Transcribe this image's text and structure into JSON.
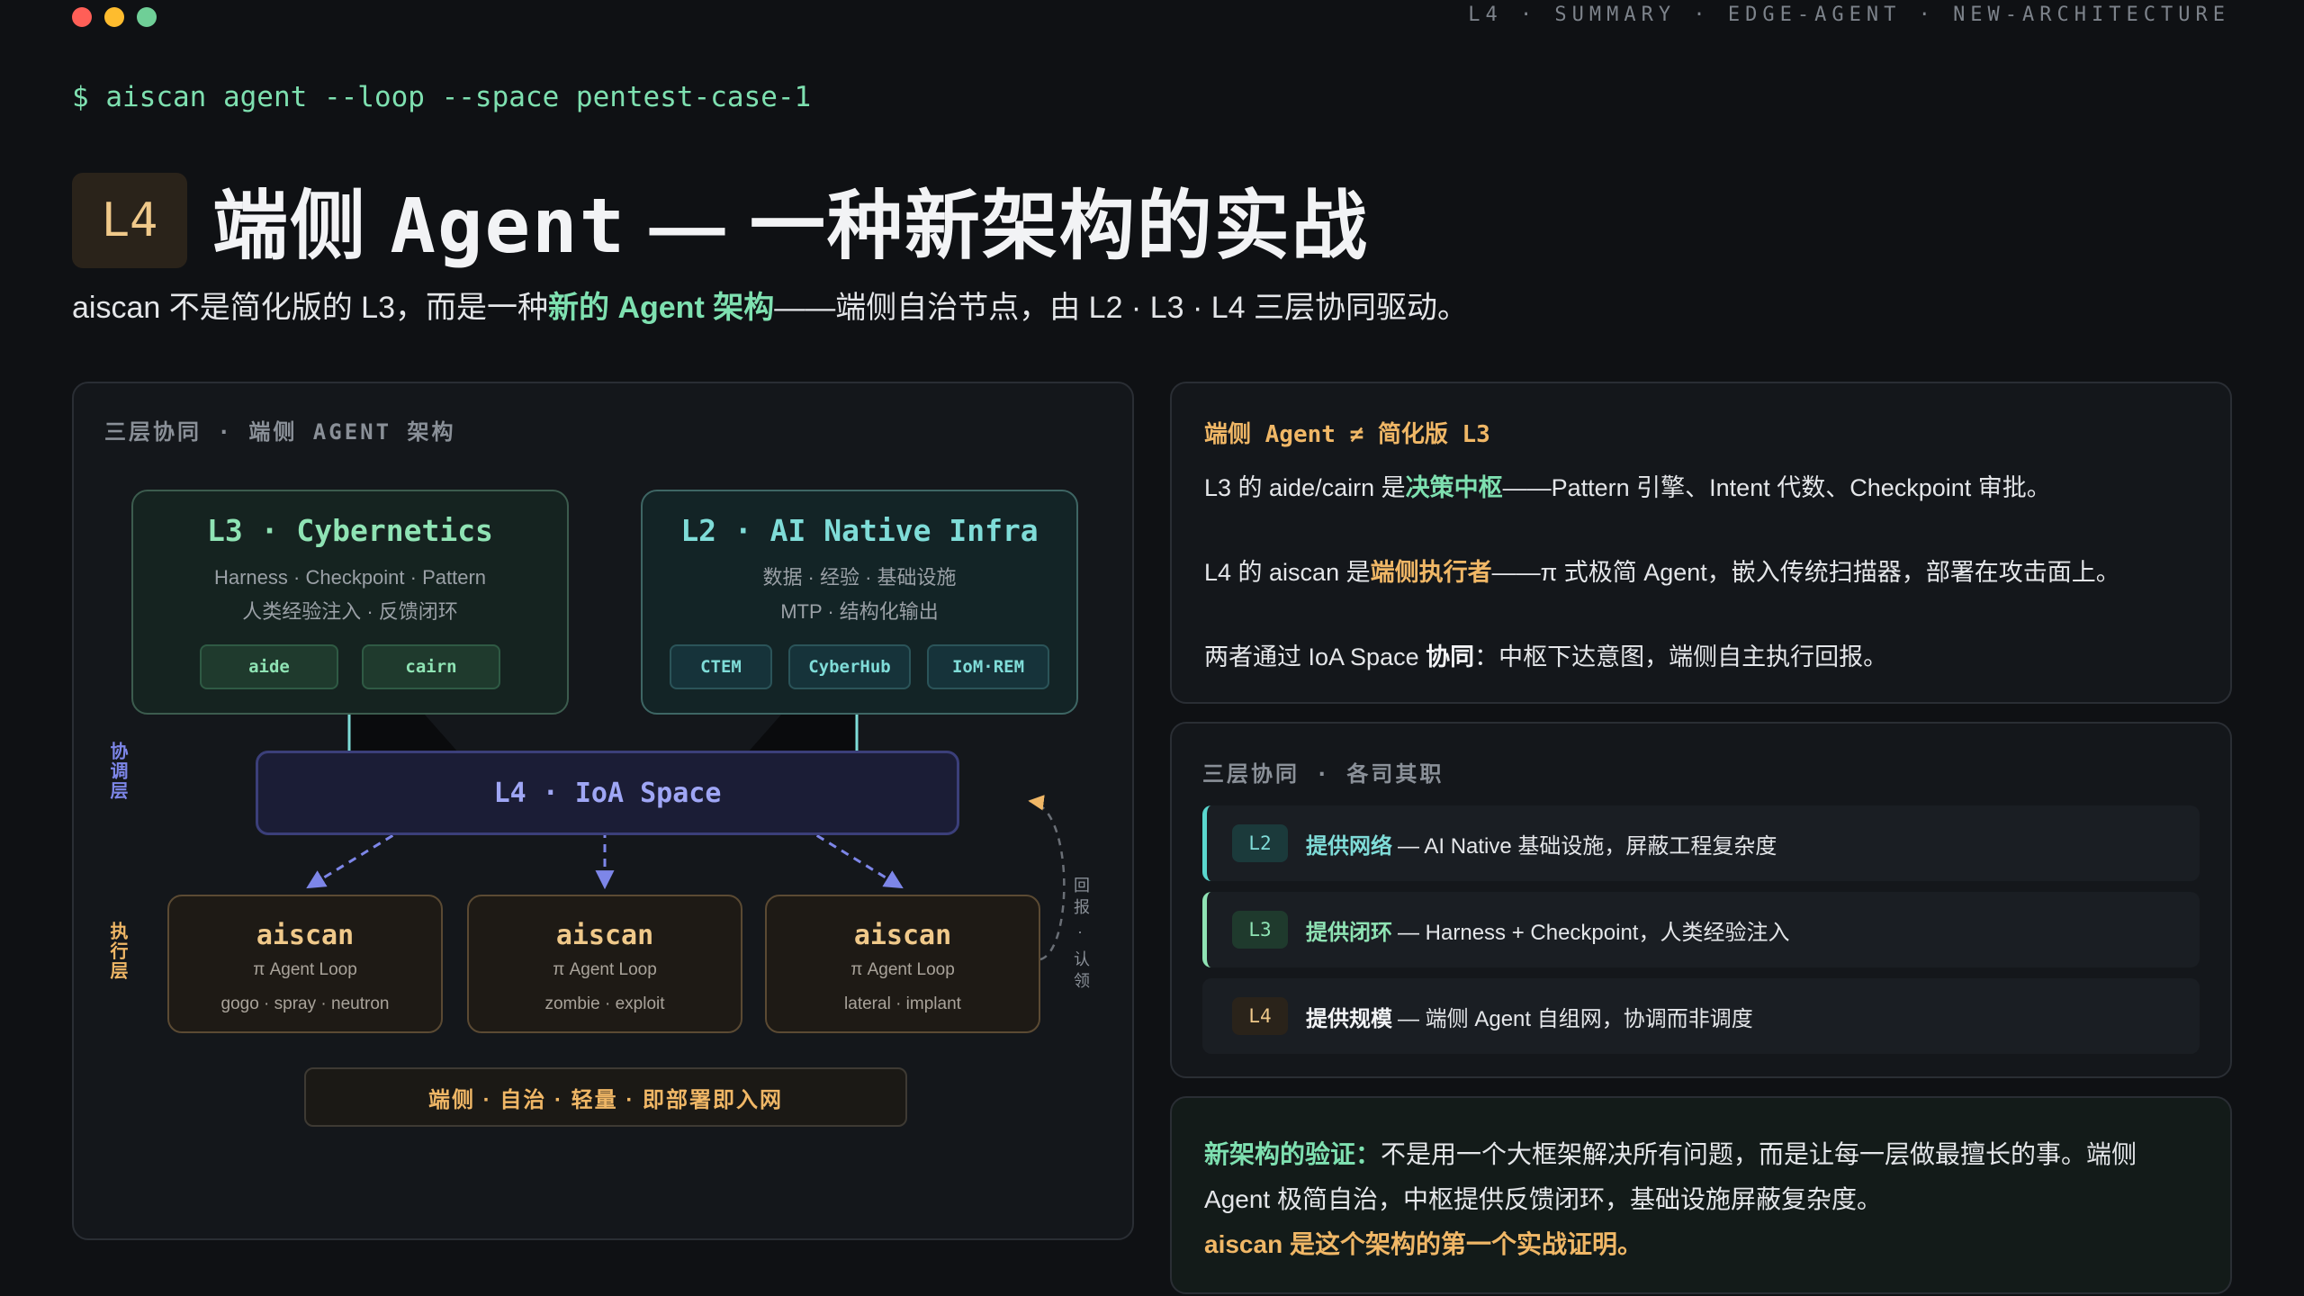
{
  "window": {
    "breadcrumb": "L4 · SUMMARY · EDGE-AGENT · NEW-ARCHITECTURE"
  },
  "prompt": "$ aiscan agent --loop --space pentest-case-1",
  "title": {
    "badge": "L4",
    "text_a": "端侧 ",
    "text_mono": "Agent",
    "text_b": " — 一种新架构的实战"
  },
  "subtitle": {
    "before": "aiscan 不是简化版的 L3，而是一种",
    "highlight": "新的 Agent 架构",
    "after": "——端侧自治节点，由 L2 · L3 · L4 三层协同驱动。"
  },
  "diagram": {
    "label": "三层协同 · 端侧 AGENT 架构",
    "l3": {
      "title": "L3 · Cybernetics",
      "sub1": "Harness · Checkpoint · Pattern",
      "sub2": "人类经验注入 · 反馈闭环",
      "chips": [
        "aide",
        "cairn"
      ]
    },
    "l2": {
      "title": "L2 · AI Native Infra",
      "sub1": "数据 · 经验 · 基础设施",
      "sub2": "MTP · 结构化输出",
      "chips": [
        "CTEM",
        "CyberHub",
        "IoM·REM"
      ]
    },
    "ioa": "L4 · IoA Space",
    "side_coord": "协调层",
    "side_exec": "执行层",
    "side_report": "回报 · 认领",
    "nodes": [
      {
        "title": "aiscan",
        "sub": "π Agent Loop",
        "tags": "gogo · spray · neutron"
      },
      {
        "title": "aiscan",
        "sub": "π Agent Loop",
        "tags": "zombie · exploit"
      },
      {
        "title": "aiscan",
        "sub": "π Agent Loop",
        "tags": "lateral · implant"
      }
    ],
    "footer": "端侧 · 自治 · 轻量 · 即部署即入网",
    "colors": {
      "l3": "#8fe3b4",
      "l2": "#7fdcd8",
      "ioa": "#7d86e8",
      "exec": "#f0b766"
    }
  },
  "card1": {
    "head": "端侧 Agent ≠ 简化版 L3",
    "line1": {
      "a": "L3 的 aide/cairn 是",
      "hl": "决策中枢",
      "b": "——Pattern 引擎、Intent 代数、Checkpoint 审批。"
    },
    "line2": {
      "a": "L4 的 aiscan 是",
      "hl": "端侧执行者",
      "b": "——π 式极简 Agent，嵌入传统扫描器，部署在攻击面上。"
    },
    "line3": {
      "a": "两者通过 IoA Space ",
      "hl": "协同",
      "b": "：中枢下达意图，端侧自主执行回报。"
    }
  },
  "card2": {
    "label": "三层协同 · 各司其职",
    "roles": [
      {
        "badge": "L2",
        "key": "提供网络",
        "desc": "— AI Native 基础设施，屏蔽工程复杂度"
      },
      {
        "badge": "L3",
        "key": "提供闭环",
        "desc": "— Harness + Checkpoint，人类经验注入"
      },
      {
        "badge": "L4",
        "key": "提供规模",
        "desc": "— 端侧 Agent 自组网，协调而非调度"
      }
    ]
  },
  "card3": {
    "lead": "新架构的验证：",
    "body1": "不是用一个大框架解决所有问题，而是让每一层做最擅长的事。端侧",
    "body2": "Agent 极简自治，中枢提供反馈闭环，基础设施屏蔽复杂度。",
    "conclusion": "aiscan 是这个架构的第一个实战证明。"
  }
}
